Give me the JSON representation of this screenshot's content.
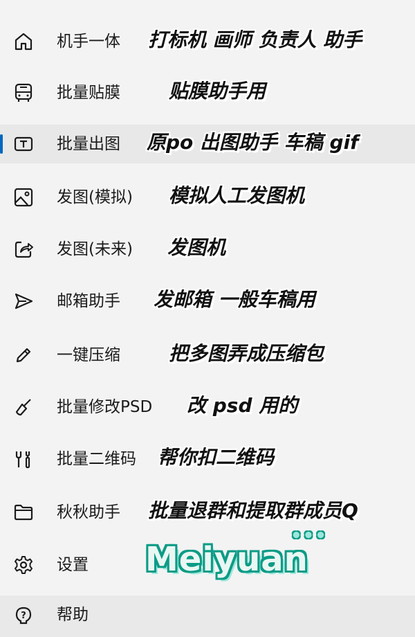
{
  "menu": {
    "items": [
      {
        "label": "机手一体",
        "note": "打标机 画师 负责人 助手",
        "icon": "home-icon"
      },
      {
        "label": "批量贴膜",
        "note": "贴膜助手用",
        "icon": "bus-icon"
      },
      {
        "label": "批量出图",
        "note": "原po 出图助手 车稿 gif",
        "icon": "text-box-icon"
      },
      {
        "label": "发图(模拟)",
        "note": "模拟人工发图机",
        "icon": "image-icon"
      },
      {
        "label": "发图(未来)",
        "note": "发图机",
        "icon": "share-icon"
      },
      {
        "label": "邮箱助手",
        "note": "发邮箱 一般车稿用",
        "icon": "send-icon"
      },
      {
        "label": "一键压缩",
        "note": "把多图弄成压缩包",
        "icon": "pencil-icon"
      },
      {
        "label": "批量修改PSD",
        "note": "改 psd 用的",
        "icon": "broom-icon"
      },
      {
        "label": "批量二维码",
        "note": "帮你扣二维码",
        "icon": "tools-icon"
      },
      {
        "label": "秋秋助手",
        "note": "批量退群和提取群成员Q",
        "icon": "folder-icon"
      },
      {
        "label": "设置",
        "note": "",
        "icon": "gear-icon"
      },
      {
        "label": "帮助",
        "note": "",
        "icon": "help-icon"
      }
    ]
  },
  "watermark": {
    "text": "Meiyuan",
    "dots": "•••"
  },
  "colors": {
    "accent": "#0067c0",
    "background": "#f3f3f3",
    "selected": "#e8e8e8",
    "watermark": "#0c9b86"
  }
}
